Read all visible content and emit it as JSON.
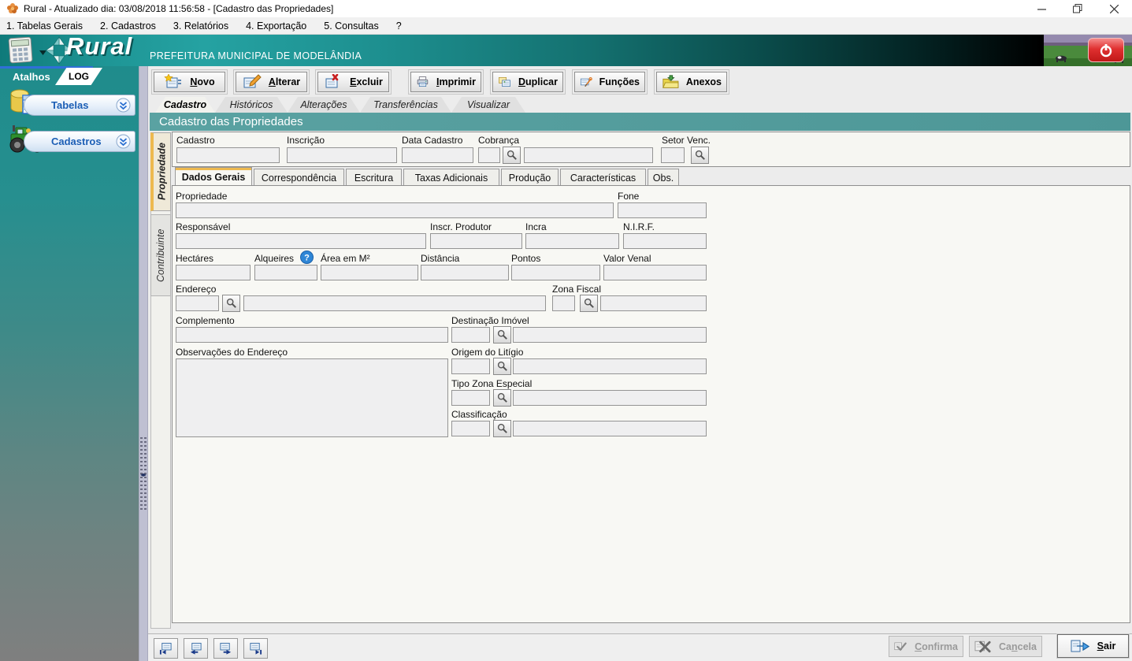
{
  "titlebar": {
    "title": "Rural - Atualizado dia: 03/08/2018 11:56:58 - [Cadastro das Propriedades]"
  },
  "menubar": {
    "items": [
      "1. Tabelas Gerais",
      "2. Cadastros",
      "3. Relatórios",
      "4. Exportação",
      "5. Consultas",
      "?"
    ]
  },
  "header": {
    "logo_text": "Rural",
    "org": "PREFEITURA MUNICIPAL DE MODELÂNDIA"
  },
  "sidebar": {
    "tab_atalhos": "Atalhos",
    "tab_log": "LOG",
    "items": [
      {
        "label": "Tabelas",
        "icon": "database-table-icon"
      },
      {
        "label": "Cadastros",
        "icon": "tractor-icon"
      }
    ]
  },
  "toolbar": {
    "buttons": [
      {
        "label": "Novo",
        "accel": 0,
        "icon": "new-record-icon"
      },
      {
        "label": "Alterar",
        "accel": 0,
        "icon": "edit-record-icon"
      },
      {
        "label": "Excluir",
        "accel": 0,
        "icon": "delete-record-icon"
      },
      {
        "label": "Imprimir",
        "accel": 0,
        "icon": "print-icon"
      },
      {
        "label": "Duplicar",
        "accel": 0,
        "icon": "duplicate-icon"
      },
      {
        "label": "Funções",
        "accel": -1,
        "icon": "functions-icon"
      },
      {
        "label": "Anexos",
        "accel": -1,
        "icon": "attachments-icon"
      }
    ]
  },
  "main_tabs": [
    {
      "label": "Cadastro",
      "active": true
    },
    {
      "label": "Históricos",
      "active": false
    },
    {
      "label": "Alterações",
      "active": false
    },
    {
      "label": "Transferências",
      "active": false
    },
    {
      "label": "Visualizar",
      "active": false
    }
  ],
  "page_title": "Cadastro das Propriedades",
  "vertical_tabs": [
    {
      "label": "Propriedade",
      "active": true
    },
    {
      "label": "Contribuinte",
      "active": false
    }
  ],
  "top_fields": {
    "cadastro": "Cadastro",
    "inscricao": "Inscrição",
    "data_cadastro": "Data Cadastro",
    "cobranca": "Cobrança",
    "setor_venc": "Setor Venc."
  },
  "subtabs": [
    {
      "label": "Dados Gerais",
      "active": true
    },
    {
      "label": "Correspondência",
      "active": false
    },
    {
      "label": "Escritura",
      "active": false
    },
    {
      "label": "Taxas Adicionais",
      "active": false
    },
    {
      "label": "Produção",
      "active": false
    },
    {
      "label": "Características",
      "active": false
    },
    {
      "label": "Obs.",
      "active": false
    }
  ],
  "form": {
    "propriedade": "Propriedade",
    "fone": "Fone",
    "responsavel": "Responsável",
    "inscr_produtor": "Inscr. Produtor",
    "incra": "Incra",
    "nirf": "N.I.R.F.",
    "hectares": "Hectáres",
    "alqueires": "Alqueires",
    "area_m2": "Área em M²",
    "distancia": "Distância",
    "pontos": "Pontos",
    "valor_venal": "Valor Venal",
    "endereco": "Endereço",
    "zona_fiscal": "Zona Fiscal",
    "complemento": "Complemento",
    "destinacao_imovel": "Destinação Imóvel",
    "observacoes_endereco": "Observações do Endereço",
    "origem_litigio": "Origem do Litígio",
    "tipo_zona_especial": "Tipo Zona Especial",
    "classificacao": "Classificação"
  },
  "bottom": {
    "confirma": {
      "label": "Confirma",
      "accel": 0
    },
    "cancela": {
      "label": "Cancela",
      "accel": 2
    },
    "sair": {
      "label": "Sair",
      "accel": 0
    }
  },
  "colors": {
    "teal": "#1f8c8c",
    "title_band": "#4e9b9b",
    "accent_orange": "#edb94f",
    "link_blue": "#1b5eb5",
    "power_red": "#d42f2f"
  }
}
